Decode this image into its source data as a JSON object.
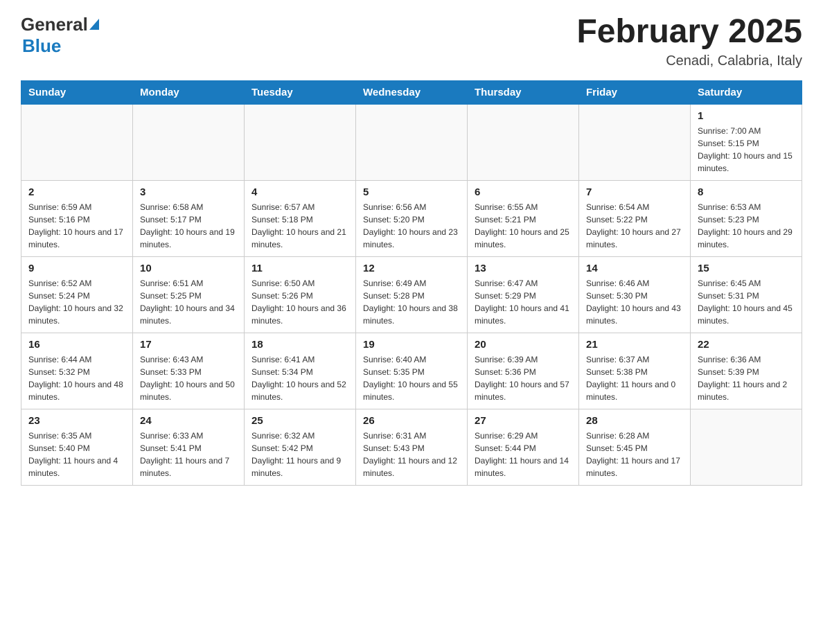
{
  "header": {
    "logo_general": "General",
    "logo_blue": "Blue",
    "month_title": "February 2025",
    "location": "Cenadi, Calabria, Italy"
  },
  "days_of_week": [
    "Sunday",
    "Monday",
    "Tuesday",
    "Wednesday",
    "Thursday",
    "Friday",
    "Saturday"
  ],
  "weeks": [
    [
      {
        "day": "",
        "info": ""
      },
      {
        "day": "",
        "info": ""
      },
      {
        "day": "",
        "info": ""
      },
      {
        "day": "",
        "info": ""
      },
      {
        "day": "",
        "info": ""
      },
      {
        "day": "",
        "info": ""
      },
      {
        "day": "1",
        "info": "Sunrise: 7:00 AM\nSunset: 5:15 PM\nDaylight: 10 hours and 15 minutes."
      }
    ],
    [
      {
        "day": "2",
        "info": "Sunrise: 6:59 AM\nSunset: 5:16 PM\nDaylight: 10 hours and 17 minutes."
      },
      {
        "day": "3",
        "info": "Sunrise: 6:58 AM\nSunset: 5:17 PM\nDaylight: 10 hours and 19 minutes."
      },
      {
        "day": "4",
        "info": "Sunrise: 6:57 AM\nSunset: 5:18 PM\nDaylight: 10 hours and 21 minutes."
      },
      {
        "day": "5",
        "info": "Sunrise: 6:56 AM\nSunset: 5:20 PM\nDaylight: 10 hours and 23 minutes."
      },
      {
        "day": "6",
        "info": "Sunrise: 6:55 AM\nSunset: 5:21 PM\nDaylight: 10 hours and 25 minutes."
      },
      {
        "day": "7",
        "info": "Sunrise: 6:54 AM\nSunset: 5:22 PM\nDaylight: 10 hours and 27 minutes."
      },
      {
        "day": "8",
        "info": "Sunrise: 6:53 AM\nSunset: 5:23 PM\nDaylight: 10 hours and 29 minutes."
      }
    ],
    [
      {
        "day": "9",
        "info": "Sunrise: 6:52 AM\nSunset: 5:24 PM\nDaylight: 10 hours and 32 minutes."
      },
      {
        "day": "10",
        "info": "Sunrise: 6:51 AM\nSunset: 5:25 PM\nDaylight: 10 hours and 34 minutes."
      },
      {
        "day": "11",
        "info": "Sunrise: 6:50 AM\nSunset: 5:26 PM\nDaylight: 10 hours and 36 minutes."
      },
      {
        "day": "12",
        "info": "Sunrise: 6:49 AM\nSunset: 5:28 PM\nDaylight: 10 hours and 38 minutes."
      },
      {
        "day": "13",
        "info": "Sunrise: 6:47 AM\nSunset: 5:29 PM\nDaylight: 10 hours and 41 minutes."
      },
      {
        "day": "14",
        "info": "Sunrise: 6:46 AM\nSunset: 5:30 PM\nDaylight: 10 hours and 43 minutes."
      },
      {
        "day": "15",
        "info": "Sunrise: 6:45 AM\nSunset: 5:31 PM\nDaylight: 10 hours and 45 minutes."
      }
    ],
    [
      {
        "day": "16",
        "info": "Sunrise: 6:44 AM\nSunset: 5:32 PM\nDaylight: 10 hours and 48 minutes."
      },
      {
        "day": "17",
        "info": "Sunrise: 6:43 AM\nSunset: 5:33 PM\nDaylight: 10 hours and 50 minutes."
      },
      {
        "day": "18",
        "info": "Sunrise: 6:41 AM\nSunset: 5:34 PM\nDaylight: 10 hours and 52 minutes."
      },
      {
        "day": "19",
        "info": "Sunrise: 6:40 AM\nSunset: 5:35 PM\nDaylight: 10 hours and 55 minutes."
      },
      {
        "day": "20",
        "info": "Sunrise: 6:39 AM\nSunset: 5:36 PM\nDaylight: 10 hours and 57 minutes."
      },
      {
        "day": "21",
        "info": "Sunrise: 6:37 AM\nSunset: 5:38 PM\nDaylight: 11 hours and 0 minutes."
      },
      {
        "day": "22",
        "info": "Sunrise: 6:36 AM\nSunset: 5:39 PM\nDaylight: 11 hours and 2 minutes."
      }
    ],
    [
      {
        "day": "23",
        "info": "Sunrise: 6:35 AM\nSunset: 5:40 PM\nDaylight: 11 hours and 4 minutes."
      },
      {
        "day": "24",
        "info": "Sunrise: 6:33 AM\nSunset: 5:41 PM\nDaylight: 11 hours and 7 minutes."
      },
      {
        "day": "25",
        "info": "Sunrise: 6:32 AM\nSunset: 5:42 PM\nDaylight: 11 hours and 9 minutes."
      },
      {
        "day": "26",
        "info": "Sunrise: 6:31 AM\nSunset: 5:43 PM\nDaylight: 11 hours and 12 minutes."
      },
      {
        "day": "27",
        "info": "Sunrise: 6:29 AM\nSunset: 5:44 PM\nDaylight: 11 hours and 14 minutes."
      },
      {
        "day": "28",
        "info": "Sunrise: 6:28 AM\nSunset: 5:45 PM\nDaylight: 11 hours and 17 minutes."
      },
      {
        "day": "",
        "info": ""
      }
    ]
  ]
}
